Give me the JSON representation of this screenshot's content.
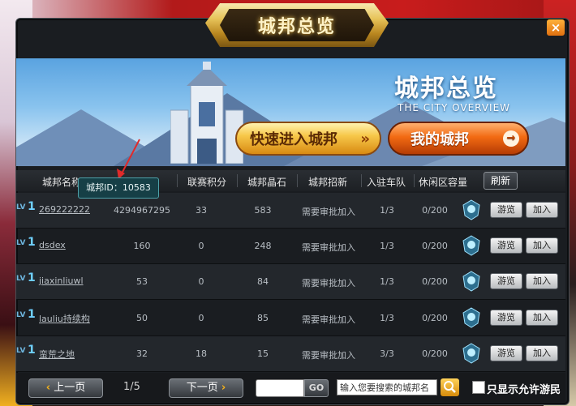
{
  "window": {
    "title": "城邦总览",
    "close_label": "×"
  },
  "banner": {
    "title": "城邦总览",
    "subtitle": "THE CITY OVERVIEW",
    "quick_enter": "快速进入城邦",
    "quick_enter_arrow": "»",
    "my_city": "我的城邦",
    "my_city_arrow": "→"
  },
  "table": {
    "columns": [
      "城邦名称",
      "",
      "联赛积分",
      "城邦晶石",
      "城邦招新",
      "入驻车队",
      "休闲区容量"
    ],
    "refresh_label": "刷新",
    "lv_prefix": "LV",
    "rows": [
      {
        "level": "1",
        "name": "269222222",
        "value": "4294967295",
        "points": "33",
        "crystal": "583",
        "recruit": "需要审批加入",
        "teams": "1/3",
        "capacity": "0/200",
        "browse": "游览",
        "join": "加入"
      },
      {
        "level": "1",
        "name": "dsdex",
        "value": "160",
        "points": "0",
        "crystal": "248",
        "recruit": "需要审批加入",
        "teams": "1/3",
        "capacity": "0/200",
        "browse": "游览",
        "join": "加入"
      },
      {
        "level": "1",
        "name": "jiaxinliuwl",
        "value": "53",
        "points": "0",
        "crystal": "84",
        "recruit": "需要审批加入",
        "teams": "1/3",
        "capacity": "0/200",
        "browse": "游览",
        "join": "加入"
      },
      {
        "level": "1",
        "name": "lauliu持续构",
        "value": "50",
        "points": "0",
        "crystal": "85",
        "recruit": "需要审批加入",
        "teams": "1/3",
        "capacity": "0/200",
        "browse": "游览",
        "join": "加入"
      },
      {
        "level": "1",
        "name": "蛮荒之地",
        "value": "32",
        "points": "18",
        "crystal": "15",
        "recruit": "需要审批加入",
        "teams": "3/3",
        "capacity": "0/200",
        "browse": "游览",
        "join": "加入"
      }
    ]
  },
  "tooltip": {
    "text": "城邦ID：10583"
  },
  "footer": {
    "prev_label": "上一页",
    "next_label": "下一页",
    "page_info": "1/5",
    "go_label": "GO",
    "search_placeholder": "输入您要搜索的城邦名",
    "only_visitors_label": "只显示允许游民"
  }
}
